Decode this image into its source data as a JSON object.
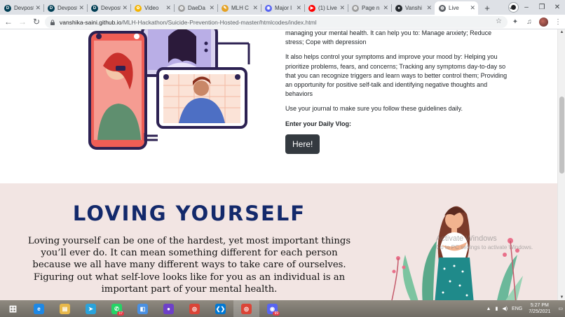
{
  "tabs": [
    {
      "label": "Devpost",
      "icon": "devpost-icon",
      "color": "#003e54",
      "letter": "D"
    },
    {
      "label": "Devpost",
      "icon": "devpost-icon",
      "color": "#003e54",
      "letter": "D"
    },
    {
      "label": "Devpost",
      "icon": "devpost-icon",
      "color": "#003e54",
      "letter": "D"
    },
    {
      "label": "Video",
      "icon": "google-photos-icon",
      "color": "#f4b400",
      "letter": "✿"
    },
    {
      "label": "DaeDa",
      "icon": "globe-icon",
      "color": "#9e9e9e",
      "letter": "◍"
    },
    {
      "label": "MLH C",
      "icon": "mlh-icon",
      "color": "#e5a224",
      "letter": "✎"
    },
    {
      "label": "Major l",
      "icon": "discord-icon",
      "color": "#5865f2",
      "letter": "◉"
    },
    {
      "label": "(1) Live",
      "icon": "youtube-icon",
      "color": "#ff0000",
      "letter": "▶"
    },
    {
      "label": "Page n",
      "icon": "globe-icon",
      "color": "#9e9e9e",
      "letter": "◍"
    },
    {
      "label": "Vanshi",
      "icon": "github-icon",
      "color": "#24292e",
      "letter": "●"
    },
    {
      "label": "Live",
      "icon": "globe-icon",
      "color": "#5f6368",
      "letter": "◍",
      "active": true
    }
  ],
  "url": {
    "host": "vanshika-saini.github.io",
    "path": "/MLH-Hackathon/Suicide-Prevention-Hosted-master/htmlcodes/index.html"
  },
  "journal": {
    "intro": "managing your mental health. It can help you to: Manage anxiety; Reduce stress; Cope with depression",
    "para2": "It also helps control your symptoms and improve your mood by: Helping you prioritize problems, fears, and concerns; Tracking any symptoms day-to-day so that you can recognize triggers and learn ways to better control them; Providing an opportunity for positive self-talk and identifying negative thoughts and behaviors",
    "para3": "Use your journal to make sure you follow these guidelines daily.",
    "vlog_label": "Enter your Daily Vlog:",
    "button_label": "Here!"
  },
  "loving": {
    "title": "LOVING YOURSELF",
    "text": "Loving yourself can be one of the hardest, yet most important things you’ll ever do. It can mean something different for each person because we all have many different ways to take care of ourselves. Figuring out what self-love looks like for you as an individual is an important part of your mental health."
  },
  "watermark": {
    "line1": "Activate Windows",
    "line2": "Go to PC settings to activate Windows."
  },
  "taskbar": {
    "apps": [
      {
        "name": "start-button",
        "glyph": "⊞",
        "color": "transparent"
      },
      {
        "name": "internet-explorer-icon",
        "glyph": "e",
        "color": "#1e88e5"
      },
      {
        "name": "file-explorer-icon",
        "glyph": "▤",
        "color": "#e8b84a"
      },
      {
        "name": "telegram-icon",
        "glyph": "➤",
        "color": "#2aa3dc"
      },
      {
        "name": "whatsapp-icon",
        "glyph": "✆",
        "color": "#25d366",
        "badge": "17"
      },
      {
        "name": "app-icon",
        "glyph": "◧",
        "color": "#4a90e2"
      },
      {
        "name": "github-desktop-icon",
        "glyph": "●",
        "color": "#6e40c9"
      },
      {
        "name": "chrome-icon",
        "glyph": "◎",
        "color": "#db4437"
      },
      {
        "name": "vscode-icon",
        "glyph": "❮❯",
        "color": "#0078d4"
      },
      {
        "name": "chrome-active-icon",
        "glyph": "◎",
        "color": "#db4437",
        "active": true
      },
      {
        "name": "discord-icon",
        "glyph": "◉",
        "color": "#5865f2",
        "badge": "99"
      }
    ],
    "lang": "ENG",
    "time": "5:27 PM",
    "date": "7/25/2021"
  }
}
